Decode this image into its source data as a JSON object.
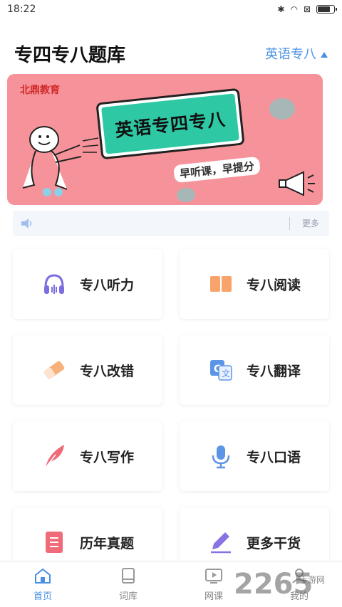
{
  "status_bar": {
    "time": "18:22"
  },
  "header": {
    "title": "专四专八题库",
    "category": "英语专八"
  },
  "banner": {
    "brand": "北鼎教育",
    "headline": "英语专四专八",
    "slogan": "早听课，早提分"
  },
  "notice": {
    "more": "更多"
  },
  "tiles": [
    {
      "label": "专八听力",
      "icon": "headphones-icon"
    },
    {
      "label": "专八阅读",
      "icon": "book-icon"
    },
    {
      "label": "专八改错",
      "icon": "eraser-icon"
    },
    {
      "label": "专八翻译",
      "icon": "translate-icon"
    },
    {
      "label": "专八写作",
      "icon": "quill-icon"
    },
    {
      "label": "专八口语",
      "icon": "microphone-icon"
    },
    {
      "label": "历年真题",
      "icon": "document-icon"
    },
    {
      "label": "更多干货",
      "icon": "pen-icon"
    }
  ],
  "tabbar": {
    "items": [
      {
        "label": "首页",
        "icon": "home-icon",
        "active": true
      },
      {
        "label": "词库",
        "icon": "vocabulary-book-icon",
        "active": false
      },
      {
        "label": "网课",
        "icon": "video-play-icon",
        "active": false
      },
      {
        "label": "我的",
        "icon": "profile-icon",
        "active": false
      }
    ]
  },
  "watermark": {
    "text": "2265",
    "sub": "手游网"
  },
  "colors": {
    "accent": "#4a90e2",
    "banner_bg": "#f6939a"
  }
}
